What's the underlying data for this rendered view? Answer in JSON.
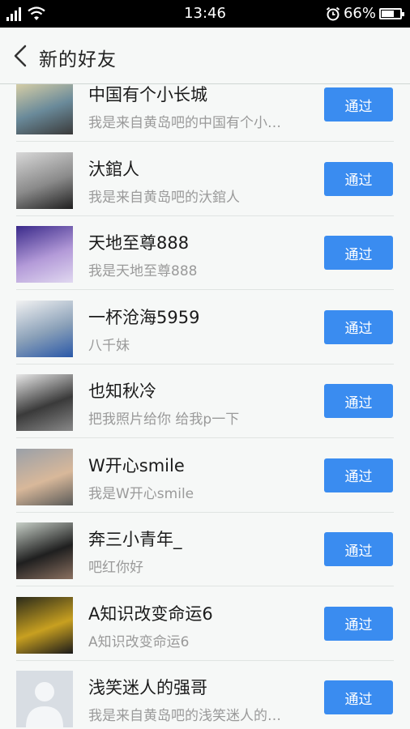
{
  "status_bar": {
    "time": "13:46",
    "battery": "66%",
    "battery_level": 0.66
  },
  "header": {
    "title": "新的好友"
  },
  "requests": [
    {
      "name": "中国有个小长城",
      "message": "我是来自黄岛吧的中国有个小…",
      "button": "通过",
      "avatar_icon": "road-landscape-avatar",
      "avatar_colors": [
        "#e8d9a8",
        "#6a8a9a",
        "#3a3a3a"
      ]
    },
    {
      "name": "汏錧人",
      "message": "我是来自黄岛吧的汏錧人",
      "button": "通过",
      "avatar_icon": "man-portrait-avatar",
      "avatar_colors": [
        "#d8d8d8",
        "#8a8a8a",
        "#1f1f1f"
      ]
    },
    {
      "name": "天地至尊888",
      "message": "我是天地至尊888",
      "button": "通过",
      "avatar_icon": "purple-anime-avatar",
      "avatar_colors": [
        "#3a2a8a",
        "#b39ad8",
        "#e0d8f0"
      ]
    },
    {
      "name": "一杯沧海5959",
      "message": "八千妹",
      "button": "通过",
      "avatar_icon": "moon-vase-avatar",
      "avatar_colors": [
        "#f2f2f2",
        "#8aa0b8",
        "#2a58a8"
      ]
    },
    {
      "name": "也知秋冷",
      "message": "把我照片给你 给我p一下",
      "button": "通过",
      "avatar_icon": "photo-grid-avatar",
      "avatar_colors": [
        "#e8e8e8",
        "#3a3a3a",
        "#888888"
      ]
    },
    {
      "name": "W开心smile",
      "message": "我是W开心smile",
      "button": "通过",
      "avatar_icon": "hand-beach-avatar",
      "avatar_colors": [
        "#9aa0a8",
        "#d8b89a",
        "#5a5a58"
      ]
    },
    {
      "name": "奔三小青年_",
      "message": "吧红你好",
      "button": "通过",
      "avatar_icon": "smiling-man-avatar",
      "avatar_colors": [
        "#c8d0c8",
        "#1f1f1f",
        "#8a7060"
      ]
    },
    {
      "name": "A知识改变命运6",
      "message": "A知识改变命运6",
      "button": "通过",
      "avatar_icon": "group-photo-avatar",
      "avatar_colors": [
        "#2a2a1a",
        "#c8a020",
        "#1a1a1a"
      ]
    },
    {
      "name": "浅笑迷人的强哥",
      "message": "我是来自黄岛吧的浅笑迷人的…",
      "button": "通过",
      "avatar_icon": "default-user-avatar",
      "avatar_colors": [
        "#d8dde3",
        "#f4f6f8",
        "#c6ccd3"
      ]
    }
  ],
  "colors": {
    "accent": "#3a8cf0",
    "background": "#f6f8f7",
    "name_text": "#1b1b1b",
    "message_text": "#9a9a9a"
  }
}
